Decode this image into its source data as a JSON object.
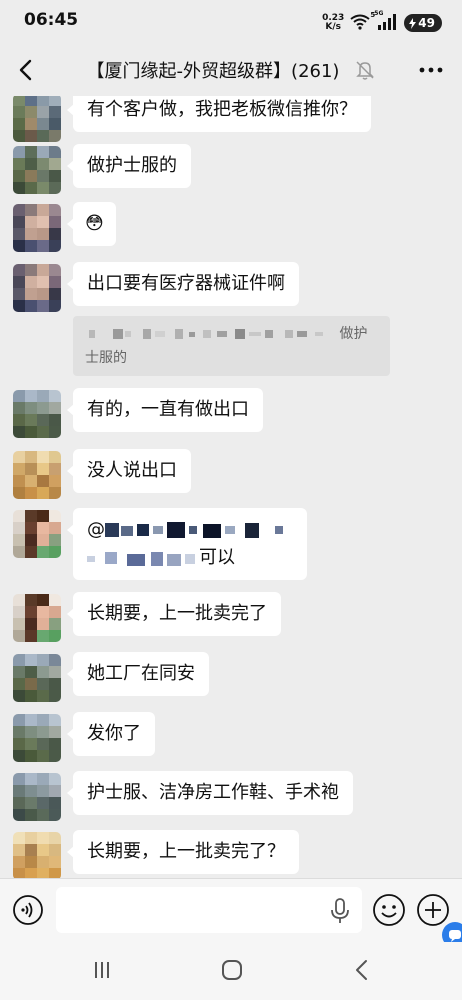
{
  "status_bar": {
    "time": "06:45",
    "net_speed_value": "0.23",
    "net_speed_unit": "K/s",
    "wifi_badge": "5",
    "signal_badge": "5G",
    "battery": "49"
  },
  "header": {
    "title": "【厦门缘起-外贸超级群】(261)",
    "back_icon": "back-arrow-icon",
    "mute_icon": "bell-off-icon",
    "more_icon": "more-icon"
  },
  "messages": [
    {
      "text": "有个客户做，我把老板微信推你？"
    },
    {
      "text": "做护士服的"
    },
    {
      "emoji": "😳"
    },
    {
      "text": "出口要有医疗器械证件啊",
      "quote": "做护士服的"
    },
    {
      "text": "有的，一直有做出口"
    },
    {
      "text": "没人说出口"
    },
    {
      "mention_prefix": "@",
      "text_suffix": "可以"
    },
    {
      "text": "长期要，上一批卖完了"
    },
    {
      "text": "她工厂在同安"
    },
    {
      "text": "发你了"
    },
    {
      "text": "护士服、洁净房工作鞋、手术袍"
    },
    {
      "text": "长期要，上一批卖完了？"
    }
  ],
  "input_bar": {
    "voice_icon": "voice-icon",
    "mic_icon": "mic-icon",
    "emoji_icon": "smile-icon",
    "plus_icon": "plus-icon"
  },
  "nav_bar": {
    "recents_icon": "recents-icon",
    "home_icon": "home-icon",
    "back_icon": "back-icon"
  }
}
